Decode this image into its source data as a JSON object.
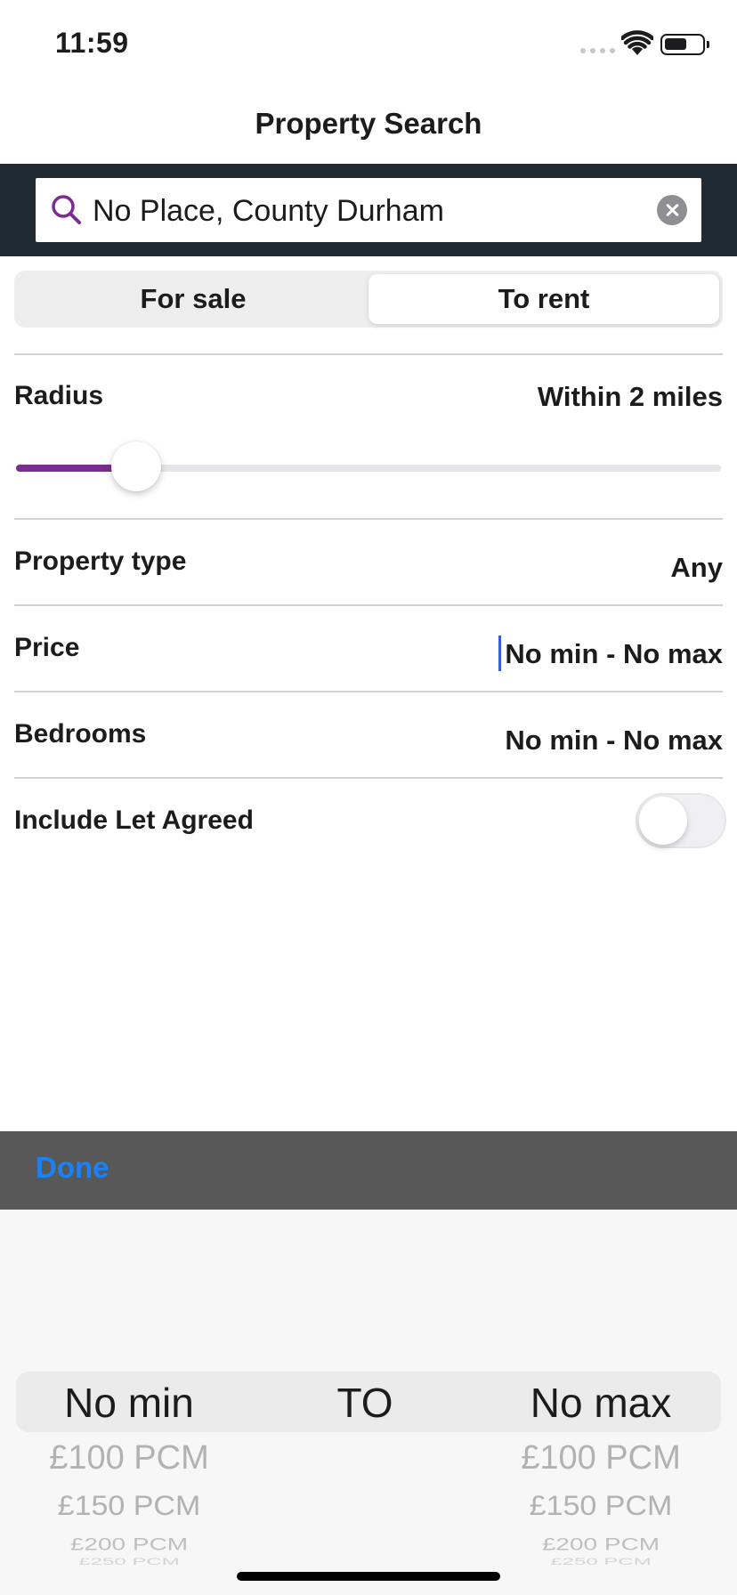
{
  "status_bar": {
    "time": "11:59"
  },
  "nav": {
    "title": "Property Search"
  },
  "search": {
    "value": "No Place, County Durham"
  },
  "segmented": {
    "for_sale": "For sale",
    "to_rent": "To rent",
    "selected": "To rent"
  },
  "radius": {
    "label": "Radius",
    "value": "Within 2 miles",
    "slider_fraction": 0.17
  },
  "property_type": {
    "label": "Property type",
    "value": "Any"
  },
  "price": {
    "label": "Price",
    "value": "No min - No max"
  },
  "bedrooms": {
    "label": "Bedrooms",
    "value": "No min - No max"
  },
  "let_agreed": {
    "label": "Include Let Agreed",
    "on": false
  },
  "picker": {
    "done_label": "Done",
    "min": {
      "selected": "No min",
      "options": [
        "£100 PCM",
        "£150 PCM",
        "£200 PCM",
        "£250 PCM"
      ]
    },
    "separator": "TO",
    "max": {
      "selected": "No max",
      "options": [
        "£100 PCM",
        "£150 PCM",
        "£200 PCM",
        "£250 PCM"
      ]
    }
  },
  "colors": {
    "accent": "#7b2d8e",
    "done": "#1a82f7",
    "search_band": "#1f2a33"
  }
}
